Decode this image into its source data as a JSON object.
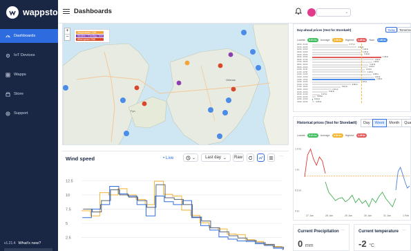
{
  "sidebar": {
    "brand": "wappsto",
    "items": [
      {
        "label": "Dashboards",
        "icon": "dashboard-icon",
        "active": true
      },
      {
        "label": "IoT Devices",
        "icon": "device-icon",
        "active": false
      },
      {
        "label": "Wapps",
        "icon": "apps-icon",
        "active": false
      },
      {
        "label": "Store",
        "icon": "store-icon",
        "active": false
      },
      {
        "label": "Support",
        "icon": "support-icon",
        "active": false
      }
    ],
    "version": "v1.21.4",
    "whats_new": "What's new?"
  },
  "header": {
    "title": "Dashboards"
  },
  "map": {
    "legend": [
      {
        "label": "Temperature / DMI",
        "color": "#f2a33a"
      },
      {
        "label": "Weather / Grønflag / DMI",
        "color": "#8a3fb2"
      },
      {
        "label": "Wind speed / DMI",
        "color": "#d9472b"
      }
    ],
    "zoom_in": "+",
    "zoom_out": "−",
    "places": [
      "Odense",
      "Fyn"
    ]
  },
  "wind": {
    "title": "Wind speed",
    "live": "• Live",
    "range": "Last day",
    "raw": "Raw",
    "yticks": [
      "12.5",
      "10",
      "7.5",
      "5",
      "2.5"
    ],
    "chart_data": {
      "type": "line",
      "title": "Wind speed",
      "xlabel": "",
      "ylabel": "",
      "ylim": [
        0,
        14
      ],
      "series": [
        {
          "color": "#f2b431",
          "values": [
            7.2,
            6.3,
            10.4,
            10.0,
            11.1,
            10.0,
            9.2,
            8.3,
            12.4,
            10.1,
            9.8,
            7.3,
            6.4,
            5.1,
            4.2,
            4.0,
            3.1,
            3.0,
            2.1,
            1.8,
            1.2,
            0.9,
            0.6
          ]
        },
        {
          "color": "#2d6cdf",
          "values": [
            6.0,
            7.5,
            8.3,
            11.5,
            10.2,
            9.8,
            8.3,
            6.3,
            9.8,
            8.8,
            8.3,
            9.0,
            6.0,
            4.6,
            3.8,
            2.6,
            2.2,
            1.9,
            1.8,
            1.4,
            1.1,
            0.6,
            0.3
          ]
        },
        {
          "color": "#5b6270",
          "values": [
            7.5,
            7.0,
            9.0,
            10.9,
            10.0,
            9.6,
            9.0,
            7.8,
            11.8,
            9.5,
            9.2,
            8.3,
            6.1,
            5.4,
            4.2,
            3.5,
            2.8,
            2.4,
            2.0,
            1.6,
            1.3,
            0.8,
            0.4
          ]
        }
      ]
    }
  },
  "day_prices": {
    "title": "Day-ahead prices (Vest for Storebælt)",
    "today": "Today",
    "tomorrow": "Tomorrow",
    "lowest_label": "Lowest:",
    "lowest": "0.01 kr.",
    "average_label": "Average:",
    "average": "1.06 kr.",
    "highest_label": "Highest:",
    "highest": "1.49 kr.",
    "now_label": "Now:",
    "now": "1.06 kr.",
    "rows": [
      {
        "time": "00:00 - 01:00",
        "value": 0.77,
        "label": "0.77 kr.",
        "color": "#e0e0e0"
      },
      {
        "time": "01:00 - 02:00",
        "value": 0.96,
        "label": "0.96 kr.",
        "color": "#e0e0e0"
      },
      {
        "time": "02:00 - 03:00",
        "value": 1.06,
        "label": "1.06 kr.",
        "color": "#e0e0e0"
      },
      {
        "time": "03:00 - 04:00",
        "value": 1.06,
        "label": "1.06 kr.",
        "color": "#e0e0e0"
      },
      {
        "time": "04:00 - 05:00",
        "value": 1.09,
        "label": "1.09 kr.",
        "color": "#e0e0e0"
      },
      {
        "time": "05:00 - 06:00",
        "value": 1.49,
        "label": "1.49 kr.",
        "color": "#e35a5a"
      },
      {
        "time": "06:00 - 07:00",
        "value": 1.32,
        "label": "1.32 kr.",
        "color": "#e0e0e0"
      },
      {
        "time": "07:00 - 08:00",
        "value": 1.29,
        "label": "1.29 kr.",
        "color": "#e0e0e0"
      },
      {
        "time": "08:00 - 09:00",
        "value": 1.21,
        "label": "1.21 kr.",
        "color": "#e0e0e0"
      },
      {
        "time": "09:00 - 10:00",
        "value": 1.19,
        "label": "1.19 kr.",
        "color": "#e0e0e0"
      },
      {
        "time": "10:00 - 11:00",
        "value": 1.13,
        "label": "1.13 kr.",
        "color": "#e0e0e0"
      },
      {
        "time": "11:00 - 12:00",
        "value": 1.16,
        "label": "1.16 kr.",
        "color": "#e0e0e0"
      },
      {
        "time": "12:00 - 13:00",
        "value": 1.28,
        "label": "1.28 kr.",
        "color": "#e0e0e0"
      },
      {
        "time": "13:00 - 14:00",
        "value": 1.32,
        "label": "1.32 kr.",
        "color": "#e0e0e0"
      },
      {
        "time": "14:00 - 15:00",
        "value": 1.36,
        "label": "1.36 kr.",
        "color": "#4a8ce8"
      },
      {
        "time": "15:00 - 16:00",
        "value": 1.03,
        "label": "1.03 kr.",
        "color": "#e0e0e0"
      },
      {
        "time": "16:00 - 17:00",
        "value": 0.83,
        "label": "0.83 kr.",
        "color": "#e0e0e0"
      },
      {
        "time": "17:00 - 18:00",
        "value": 0.61,
        "label": "0.61 kr.",
        "color": "#e0e0e0"
      },
      {
        "time": "18:00 - 19:00",
        "value": 0.41,
        "label": "0.41 kr.",
        "color": "#e0e0e0"
      },
      {
        "time": "19:00 - 20:00",
        "value": 0.33,
        "label": "0.33 kr.",
        "color": "#e0e0e0"
      },
      {
        "time": "20:00 - 21:00",
        "value": 0.17,
        "label": "0.17 kr.",
        "color": "#e0e0e0"
      },
      {
        "time": "21:00 - 22:00",
        "value": 0.08,
        "label": "0.08 kr.",
        "color": "#e0e0e0"
      },
      {
        "time": "22:00 - 23:00",
        "value": 0.01,
        "label": "0.01 kr.",
        "color": "#3fbf5b"
      },
      {
        "time": "23:00 - 00:00",
        "value": 0.05,
        "label": "0.05 kr.",
        "color": "#e0e0e0"
      }
    ],
    "lowest_color": "#3fbf5b",
    "average_color": "#f2b431",
    "highest_color": "#e35a5a",
    "now_color": "#4a8ce8"
  },
  "historical": {
    "title": "Historical prices (Vest for Storebælt)",
    "tabs": [
      {
        "label": "Day",
        "active": false
      },
      {
        "label": "Week",
        "active": true
      },
      {
        "label": "Month",
        "active": false
      },
      {
        "label": "Quarter",
        "active": false
      }
    ],
    "lowest_label": "Lowest:",
    "lowest": "0.01 kr.",
    "average_label": "Average:",
    "average": "0.84 kr.",
    "highest_label": "Highest:",
    "highest": "1.49 kr.",
    "yticks": [
      "1.5 kr.",
      "1 kr.",
      "0.5 kr.",
      "0 kr."
    ],
    "xticks": [
      "27 Jan",
      "28 Jan",
      "29 Jan",
      "30 Jan",
      "31 Jan",
      "1 Feb"
    ],
    "chart_data": {
      "type": "line",
      "title": "Historical prices (Vest for Storebælt)",
      "ylim": [
        0,
        1.6
      ],
      "average": 0.84,
      "series": [
        {
          "color": "#d83a3a",
          "values": [
            0.82,
            1.35,
            1.49,
            1.25,
            1.1,
            1.3,
            1.2,
            0.9
          ]
        },
        {
          "color": "#3fae4f",
          "values": [
            0.7,
            0.45,
            0.35,
            0.25,
            0.3,
            0.32,
            0.22,
            0.28,
            0.38,
            0.2,
            0.3,
            0.18,
            0.25,
            0.1,
            0.3,
            0.2,
            0.35,
            0.45,
            0.3,
            0.2,
            0.1,
            0.3
          ]
        },
        {
          "color": "#4a7ee0",
          "values": [
            0.5,
            0.95,
            1.05,
            0.88,
            0.7,
            0.55,
            0.6
          ]
        }
      ]
    }
  },
  "cards": [
    {
      "title": "Current Precipitation",
      "value": "0",
      "unit": "mm"
    },
    {
      "title": "Current temperature",
      "value": "-2",
      "unit": "°C"
    }
  ]
}
